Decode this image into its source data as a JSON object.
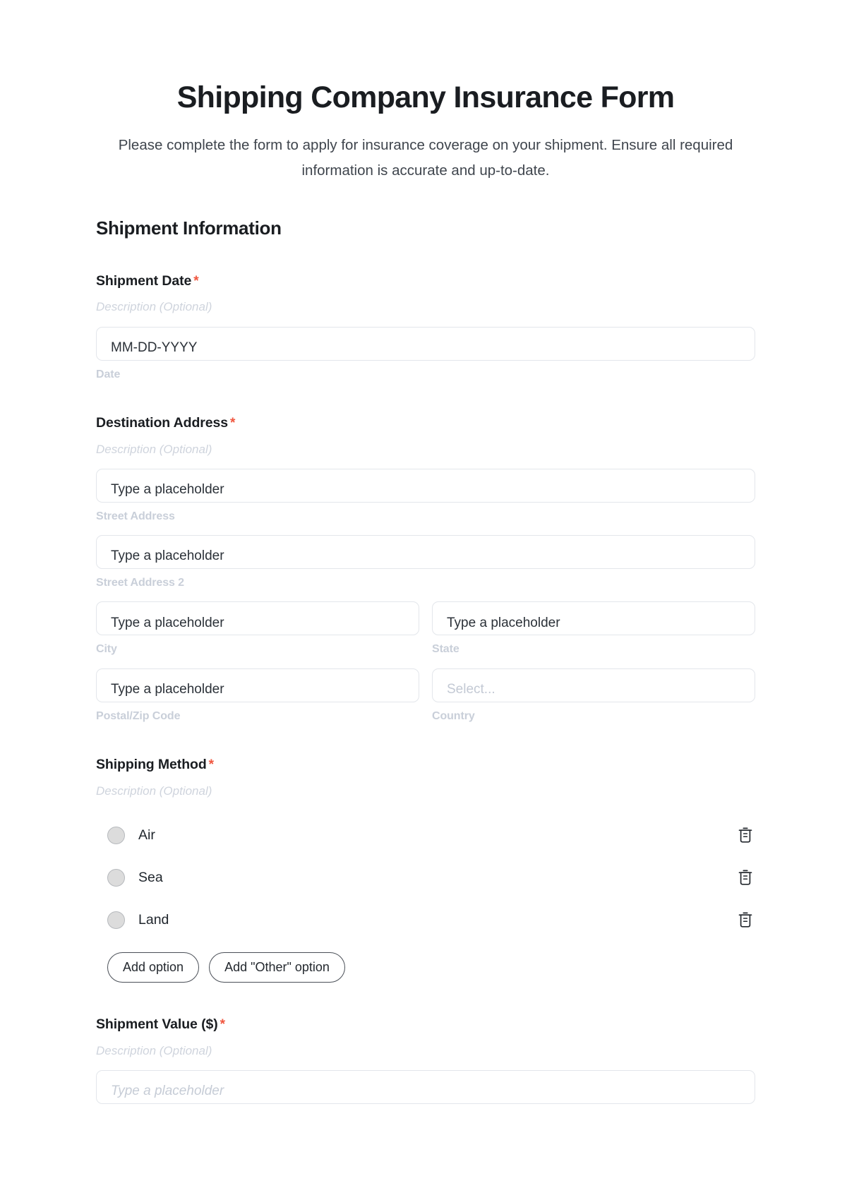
{
  "header": {
    "title": "Shipping Company Insurance Form",
    "subtitle": "Please complete the form to apply for insurance coverage on your shipment. Ensure all required information is accurate and up-to-date."
  },
  "section": {
    "heading": "Shipment Information"
  },
  "common": {
    "description_placeholder": "Description (Optional)",
    "required_mark": "*",
    "text_placeholder": "Type a placeholder",
    "select_placeholder": "Select..."
  },
  "fields": {
    "shipment_date": {
      "label": "Shipment Date",
      "description": "Description (Optional)",
      "input_value": "MM-DD-YYYY",
      "sub_label": "Date"
    },
    "destination_address": {
      "label": "Destination Address",
      "description": "Description (Optional)",
      "lines": [
        {
          "placeholder": "Type a placeholder",
          "sub_label": "Street Address"
        },
        {
          "placeholder": "Type a placeholder",
          "sub_label": "Street Address 2"
        },
        {
          "placeholder": "Type a placeholder",
          "sub_label": "City"
        },
        {
          "placeholder": "Type a placeholder",
          "sub_label": "State"
        },
        {
          "placeholder": "Type a placeholder",
          "sub_label": "Postal/Zip Code"
        },
        {
          "placeholder": "Select...",
          "sub_label": "Country"
        }
      ]
    },
    "shipping_method": {
      "label": "Shipping Method",
      "description": "Description (Optional)",
      "options": [
        {
          "label": "Air",
          "delete_icon": "trash-icon"
        },
        {
          "label": "Sea",
          "delete_icon": "trash-icon"
        },
        {
          "label": "Land",
          "delete_icon": "trash-icon"
        }
      ],
      "add_option_label": "Add option",
      "add_other_option_label": "Add \"Other\" option"
    },
    "shipment_value": {
      "label": "Shipment Value ($)",
      "description": "Description (Optional)",
      "placeholder": "Type a placeholder"
    }
  },
  "colors": {
    "required_star": "#f0563f",
    "title": "#1a1d21",
    "subtitle": "#3f454d",
    "sub_label": "#c9cfd9",
    "input_border": "#e3e6eb",
    "radio_fill": "#dcdcdc",
    "button_border": "#4a4f57"
  }
}
